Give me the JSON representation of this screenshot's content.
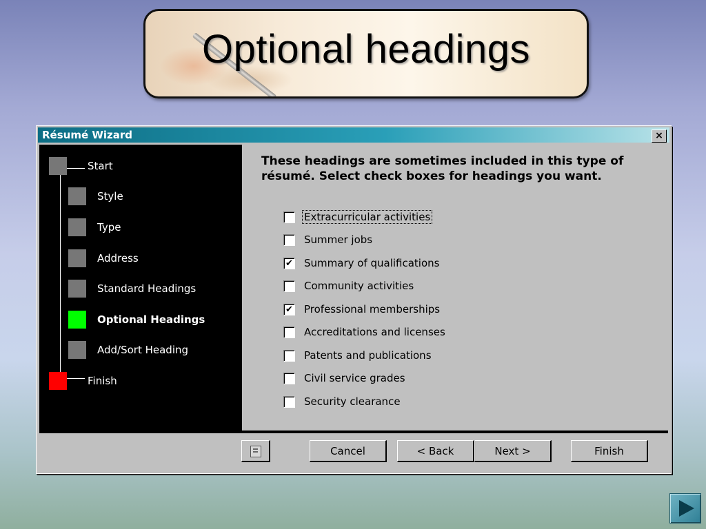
{
  "slide": {
    "title": "Optional headings"
  },
  "dialog": {
    "title": "Résumé Wizard",
    "close_label": "×",
    "steps": [
      {
        "label": "Start",
        "state": "normal"
      },
      {
        "label": "Style",
        "state": "normal"
      },
      {
        "label": "Type",
        "state": "normal"
      },
      {
        "label": "Address",
        "state": "normal"
      },
      {
        "label": "Standard Headings",
        "state": "normal"
      },
      {
        "label": "Optional Headings",
        "state": "active"
      },
      {
        "label": "Add/Sort Heading",
        "state": "normal"
      },
      {
        "label": "Finish",
        "state": "finish"
      }
    ],
    "instruction": "These headings are sometimes included in this type of résumé.  Select check boxes for headings you want.",
    "options": [
      {
        "label": "Extracurricular activities",
        "checked": false
      },
      {
        "label": "Summer jobs",
        "checked": false
      },
      {
        "label": "Summary of qualifications",
        "checked": true
      },
      {
        "label": "Community activities",
        "checked": false
      },
      {
        "label": "Professional memberships",
        "checked": true
      },
      {
        "label": "Accreditations and licenses",
        "checked": false
      },
      {
        "label": "Patents and publications",
        "checked": false
      },
      {
        "label": "Civil service grades",
        "checked": false
      },
      {
        "label": "Security clearance",
        "checked": false
      }
    ],
    "check_mark": "✔",
    "buttons": {
      "cancel": "Cancel",
      "back": "< Back",
      "next": "Next >",
      "finish": "Finish"
    }
  },
  "colors": {
    "active_step": "#00ff00",
    "finish_step": "#ff0000",
    "pending_step": "#777777",
    "titlebar": "#0c6d84"
  },
  "icons": {
    "help_button": "office-assistant-icon",
    "slide_nav": "next-slide-arrow-icon"
  }
}
